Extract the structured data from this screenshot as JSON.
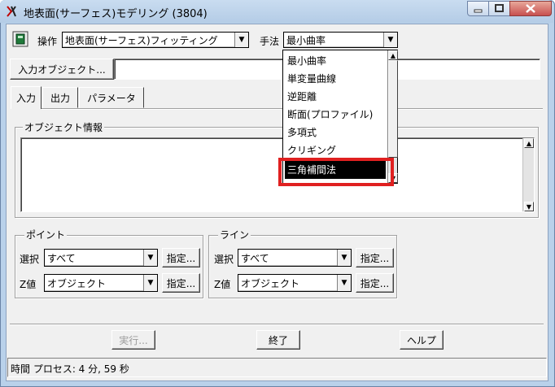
{
  "window": {
    "title": "地表面(サーフェス)モデリング (3804)"
  },
  "toolbar": {
    "operation_label": "操作",
    "operation_value": "地表面(サーフェス)フィッティング",
    "method_label": "手法",
    "method_value": "最小曲率"
  },
  "input_object_button": "入力オブジェクト...",
  "tabs": [
    {
      "label": "入力"
    },
    {
      "label": "出力"
    },
    {
      "label": "パラメータ"
    }
  ],
  "object_info": {
    "title": "オブジェクト情報"
  },
  "point_group": {
    "title": "ポイント",
    "select_label": "選択",
    "select_value": "すべて",
    "select_button": "指定...",
    "z_label": "Z値",
    "z_value": "オブジェクト",
    "z_button": "指定..."
  },
  "line_group": {
    "title": "ライン",
    "select_label": "選択",
    "select_value": "すべて",
    "select_button": "指定...",
    "z_label": "Z値",
    "z_value": "オブジェクト",
    "z_button": "指定..."
  },
  "buttons": {
    "run": "実行...",
    "exit": "終了",
    "help": "ヘルプ"
  },
  "status": "時間 プロセス: 4 分, 59 秒",
  "method_options": [
    {
      "label": "最小曲率"
    },
    {
      "label": "単変量曲線"
    },
    {
      "label": "逆距離"
    },
    {
      "label": "断面(プロファイル)"
    },
    {
      "label": "多項式"
    },
    {
      "label": "クリギング"
    },
    {
      "label": "三角補間法"
    }
  ],
  "colors": {
    "highlight": "#e02020",
    "selected_bg": "#000000"
  }
}
